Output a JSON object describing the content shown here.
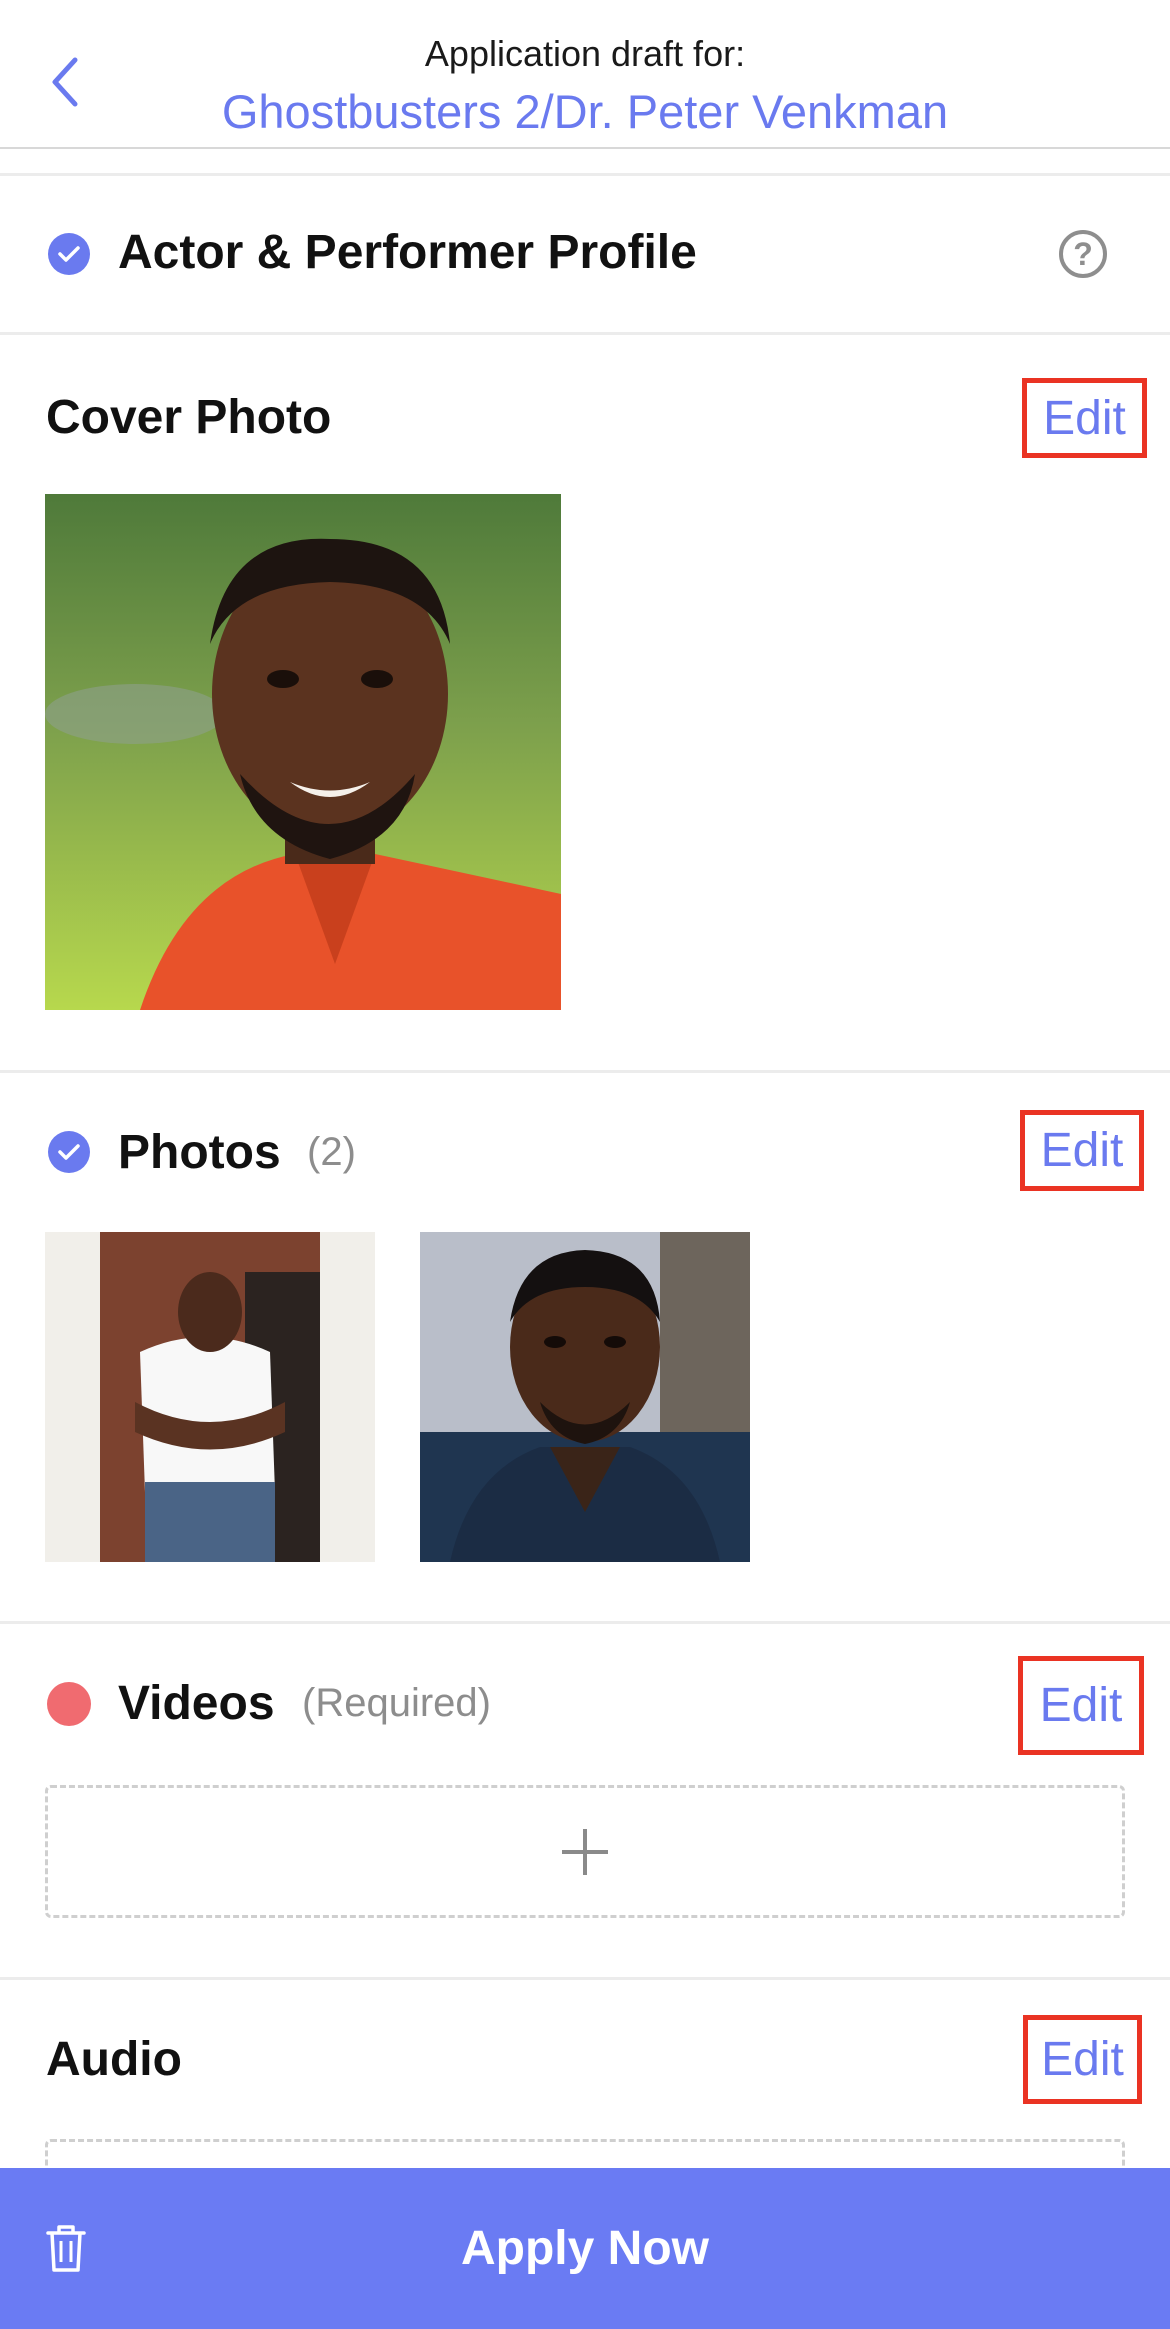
{
  "header": {
    "subtitle": "Application draft for:",
    "title": "Ghostbusters 2/Dr. Peter Venkman",
    "back_icon": "chevron-left-icon"
  },
  "profile": {
    "title": "Actor & Performer Profile",
    "status": "complete",
    "help_icon": "question-circle-icon",
    "help_glyph": "?"
  },
  "cover_photo": {
    "title": "Cover Photo",
    "edit_label": "Edit"
  },
  "photos": {
    "title": "Photos",
    "count": "(2)",
    "edit_label": "Edit",
    "status": "complete"
  },
  "videos": {
    "title": "Videos",
    "note": "(Required)",
    "edit_label": "Edit",
    "status": "required",
    "add_icon": "plus-icon"
  },
  "audio": {
    "title": "Audio",
    "edit_label": "Edit"
  },
  "footer": {
    "apply_label": "Apply Now",
    "delete_icon": "trash-icon"
  },
  "colors": {
    "accent": "#6a7aef",
    "apply_bar": "#6a7bf3",
    "required_dot": "#f06b70",
    "highlight_box": "#ea3323"
  }
}
